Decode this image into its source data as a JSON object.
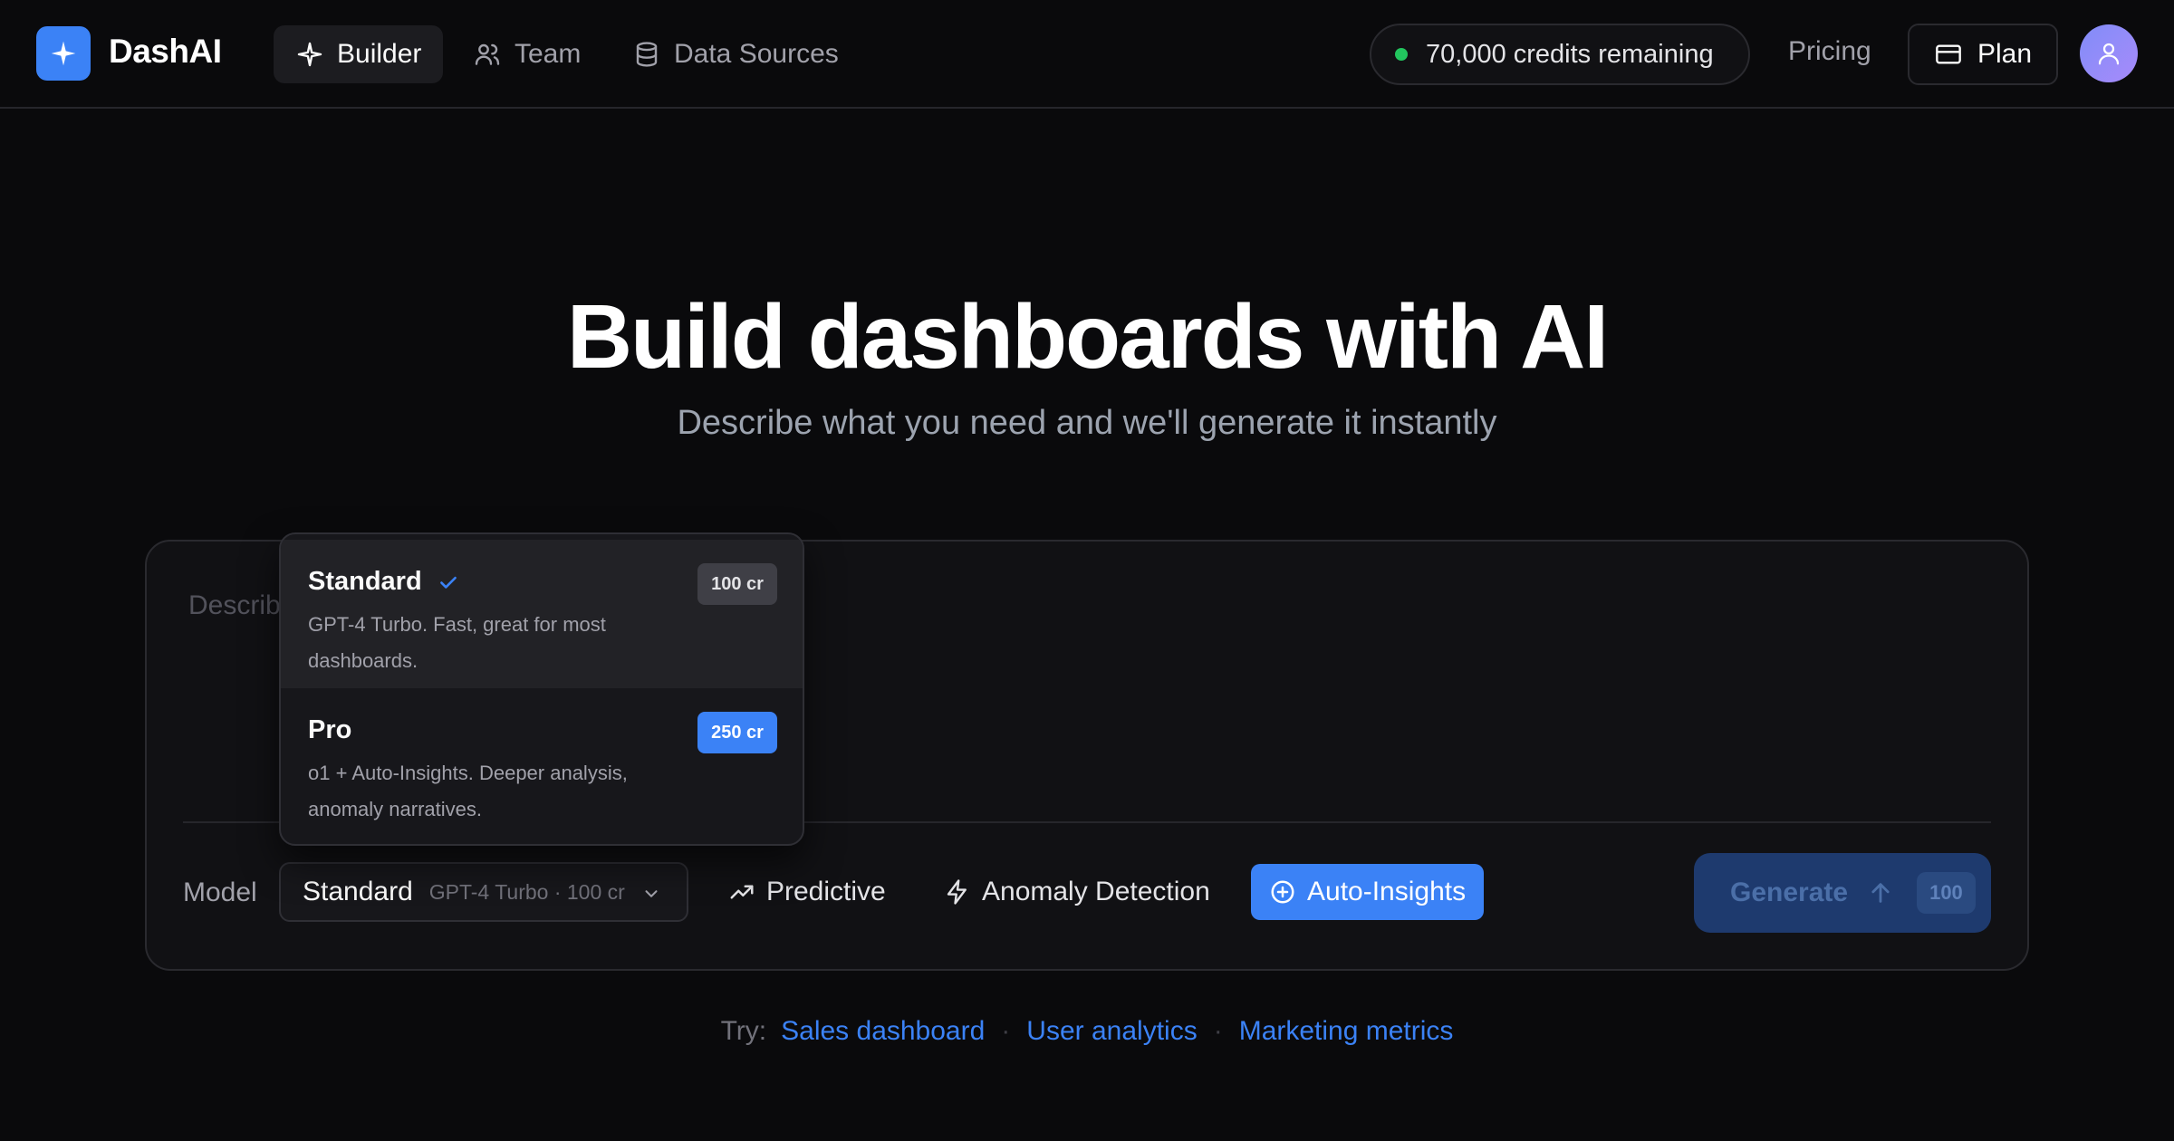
{
  "nav": {
    "brand": "DashAI",
    "items": [
      {
        "label": "Builder",
        "icon": "sparkle-icon",
        "active": true
      },
      {
        "label": "Team",
        "icon": "users-icon",
        "active": false
      },
      {
        "label": "Data Sources",
        "icon": "database-icon",
        "active": false
      }
    ],
    "credits": "70,000 credits remaining",
    "pricing": "Pricing",
    "plan": "Plan"
  },
  "hero": {
    "title": "Build dashboards with AI",
    "subtitle": "Describe what you need and we'll generate it instantly"
  },
  "composer": {
    "placeholder": "Describ",
    "model_label": "Model",
    "selected_model": "Standard",
    "selected_model_meta": "GPT-4 Turbo · 100 cr",
    "toggles": [
      {
        "label": "Predictive",
        "icon": "trend-up-icon",
        "active": false
      },
      {
        "label": "Anomaly Detection",
        "icon": "bolt-icon",
        "active": false
      },
      {
        "label": "Auto-Insights",
        "icon": "plus-circle-icon",
        "active": true
      }
    ],
    "generate_label": "Generate",
    "generate_cost": "100"
  },
  "dropdown": {
    "options": [
      {
        "name": "Standard",
        "desc": "GPT-4 Turbo. Fast, great for most dashboards.",
        "badge": "100 cr",
        "selected": true
      },
      {
        "name": "Pro",
        "desc": "o1 + Auto-Insights. Deeper analysis, anomaly narratives.",
        "badge": "250 cr",
        "selected": false
      }
    ]
  },
  "suggestions": {
    "label": "Try:",
    "items": [
      "Sales dashboard",
      "User analytics",
      "Marketing metrics"
    ]
  },
  "colors": {
    "accent": "#3b82f6",
    "background": "#0a0a0c",
    "status_green": "#22c55e"
  }
}
